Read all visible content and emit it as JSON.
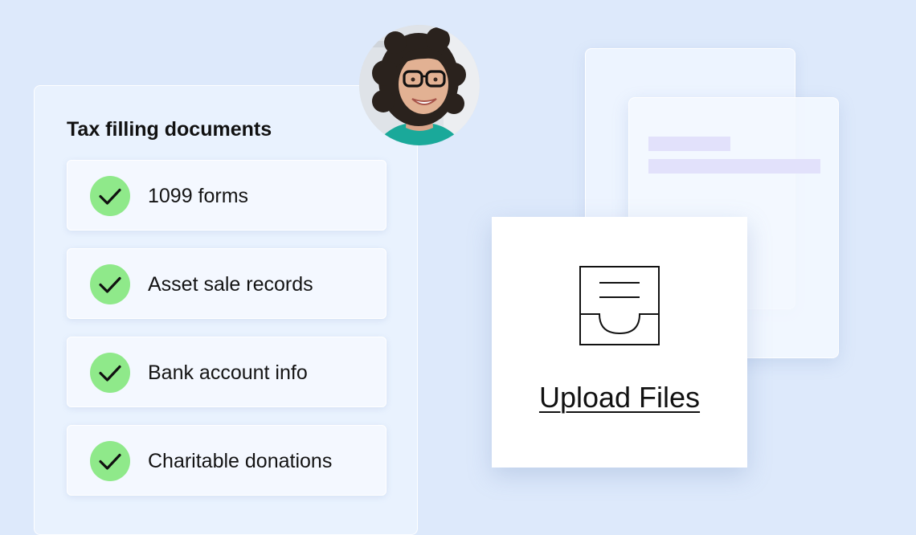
{
  "panel": {
    "title": "Tax filling documents",
    "items": [
      {
        "label": "1099 forms",
        "checked": true
      },
      {
        "label": "Asset sale records",
        "checked": true
      },
      {
        "label": "Bank account info",
        "checked": true
      },
      {
        "label": "Charitable donations",
        "checked": true
      }
    ]
  },
  "avatar": {
    "icon": "user-photo"
  },
  "upload": {
    "icon": "inbox-tray-icon",
    "label": "Upload Files"
  },
  "colors": {
    "background": "#dde9fb",
    "check_fill": "#8fe98a",
    "doc_line": "#e2e1fb",
    "card": "#ffffff"
  }
}
